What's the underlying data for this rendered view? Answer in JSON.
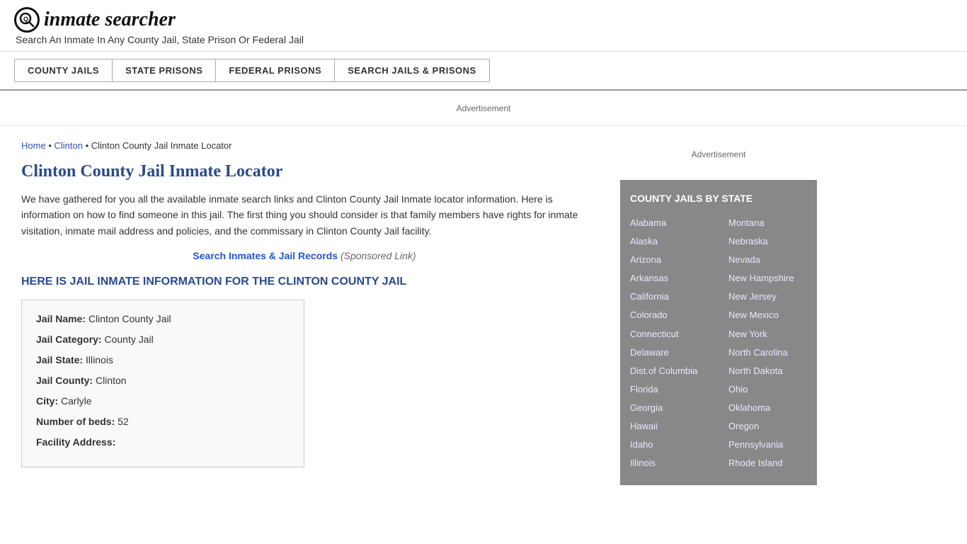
{
  "header": {
    "logo_icon": "Q",
    "logo_text": "inmate searcher",
    "tagline": "Search An Inmate In Any County Jail, State Prison Or Federal Jail"
  },
  "nav": {
    "items": [
      {
        "id": "county-jails",
        "label": "COUNTY JAILS"
      },
      {
        "id": "state-prisons",
        "label": "STATE PRISONS"
      },
      {
        "id": "federal-prisons",
        "label": "FEDERAL PRISONS"
      },
      {
        "id": "search-jails-prisons",
        "label": "SEARCH JAILS & PRISONS"
      }
    ]
  },
  "ad_label": "Advertisement",
  "breadcrumb": {
    "home": "Home",
    "state": "Clinton",
    "current": "Clinton County Jail Inmate Locator"
  },
  "page_title": "Clinton County Jail Inmate Locator",
  "description": "We have gathered for you all the available inmate search links and Clinton County Jail Inmate locator information. Here is information on how to find someone in this jail. The first thing you should consider is that family members have rights for inmate visitation, inmate mail address and policies, and the commissary in Clinton County Jail facility.",
  "sponsored_link": {
    "text": "Search Inmates & Jail Records",
    "suffix": "(Sponsored Link)"
  },
  "info_header": "HERE IS JAIL INMATE INFORMATION FOR THE CLINTON COUNTY JAIL",
  "jail_info": {
    "name_label": "Jail Name:",
    "name_value": "Clinton County Jail",
    "category_label": "Jail Category:",
    "category_value": "County Jail",
    "state_label": "Jail State:",
    "state_value": "Illinois",
    "county_label": "Jail County:",
    "county_value": "Clinton",
    "city_label": "City:",
    "city_value": "Carlyle",
    "beds_label": "Number of beds:",
    "beds_value": "52",
    "address_label": "Facility Address:"
  },
  "sidebar_ad_label": "Advertisement",
  "state_box": {
    "header": "COUNTY JAILS BY STATE",
    "col1": [
      "Alabama",
      "Alaska",
      "Arizona",
      "Arkansas",
      "California",
      "Colorado",
      "Connecticut",
      "Delaware",
      "Dist.of Columbia",
      "Florida",
      "Georgia",
      "Hawaii",
      "Idaho",
      "Illinois"
    ],
    "col2": [
      "Montana",
      "Nebraska",
      "Nevada",
      "New Hampshire",
      "New Jersey",
      "New Mexico",
      "New York",
      "North Carolina",
      "North Dakota",
      "Ohio",
      "Oklahoma",
      "Oregon",
      "Pennsylvania",
      "Rhode Island"
    ]
  }
}
